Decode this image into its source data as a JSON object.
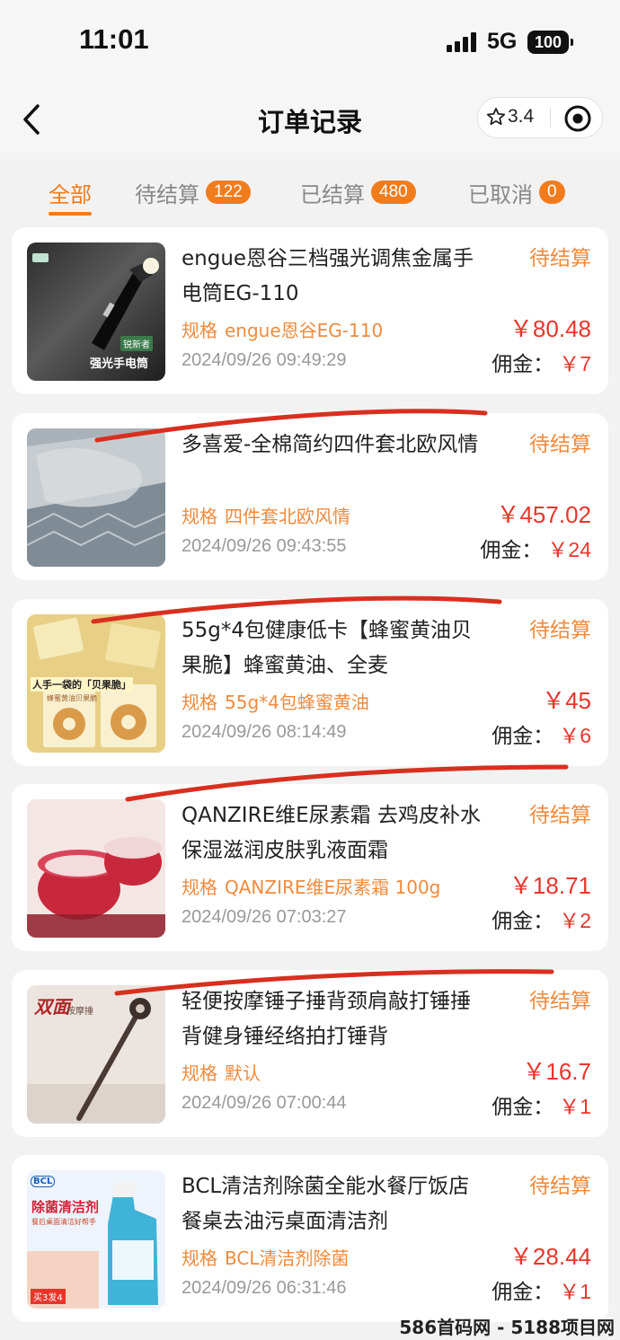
{
  "status_bar": {
    "time": "11:01",
    "network": "5G",
    "battery": "100"
  },
  "nav": {
    "title": "订单记录",
    "rating": "3.4"
  },
  "tabs": [
    {
      "label": "全部",
      "badge": ""
    },
    {
      "label": "待结算",
      "badge": "122"
    },
    {
      "label": "已结算",
      "badge": "480"
    },
    {
      "label": "已取消",
      "badge": "0"
    }
  ],
  "spec_label": "规格",
  "commission_label": "佣金：",
  "orders": [
    {
      "title": "engue恩谷三档强光调焦金属手电筒EG-110",
      "status": "待结算",
      "spec": "engue恩谷EG-110",
      "price": "￥80.48",
      "time": "2024/09/26 09:49:29",
      "commission": "￥7",
      "thumb_caption": "强光手电筒",
      "thumb_tag": "锐新者"
    },
    {
      "title": "多喜爱-全棉简约四件套北欧风情",
      "status": "待结算",
      "spec": "四件套北欧风情",
      "price": "￥457.02",
      "time": "2024/09/26 09:43:55",
      "commission": "￥24"
    },
    {
      "title": "55g*4包健康低卡【蜂蜜黄油贝果脆】蜂蜜黄油、全麦",
      "status": "待结算",
      "spec": "55g*4包蜂蜜黄油",
      "price": "￥45",
      "time": "2024/09/26 08:14:49",
      "commission": "￥6",
      "thumb_caption": "人手一袋的「贝果脆」",
      "thumb_sub": "蜂蜜黄油贝果脆"
    },
    {
      "title": "QANZIRE维E尿素霜 去鸡皮补水保湿滋润皮肤乳液面霜",
      "status": "待结算",
      "spec": "QANZIRE维E尿素霜 100g",
      "price": "￥18.71",
      "time": "2024/09/26 07:03:27",
      "commission": "￥2"
    },
    {
      "title": "轻便按摩锤子捶背颈肩敲打锤捶背健身锤经络拍打锤背",
      "status": "待结算",
      "spec": "默认",
      "price": "￥16.7",
      "time": "2024/09/26 07:00:44",
      "commission": "￥1",
      "thumb_caption": "双面",
      "thumb_sub": "按摩捶"
    },
    {
      "title": "BCL清洁剂除菌全能水餐厅饭店餐桌去油污桌面清洁剂",
      "status": "待结算",
      "spec": "BCL清洁剂除菌",
      "price": "￥28.44",
      "time": "2024/09/26 06:31:46",
      "commission": "￥1",
      "thumb_brand": "BCL",
      "thumb_caption": "除菌清洁剂",
      "thumb_sub": "餐后桌面清洁好帮手",
      "thumb_promo": "买3发4"
    }
  ],
  "watermark": "586首码网 - 5188项目网",
  "colors": {
    "accent": "#f07c1e",
    "price": "#e8352b",
    "status": "#f08a3c"
  }
}
